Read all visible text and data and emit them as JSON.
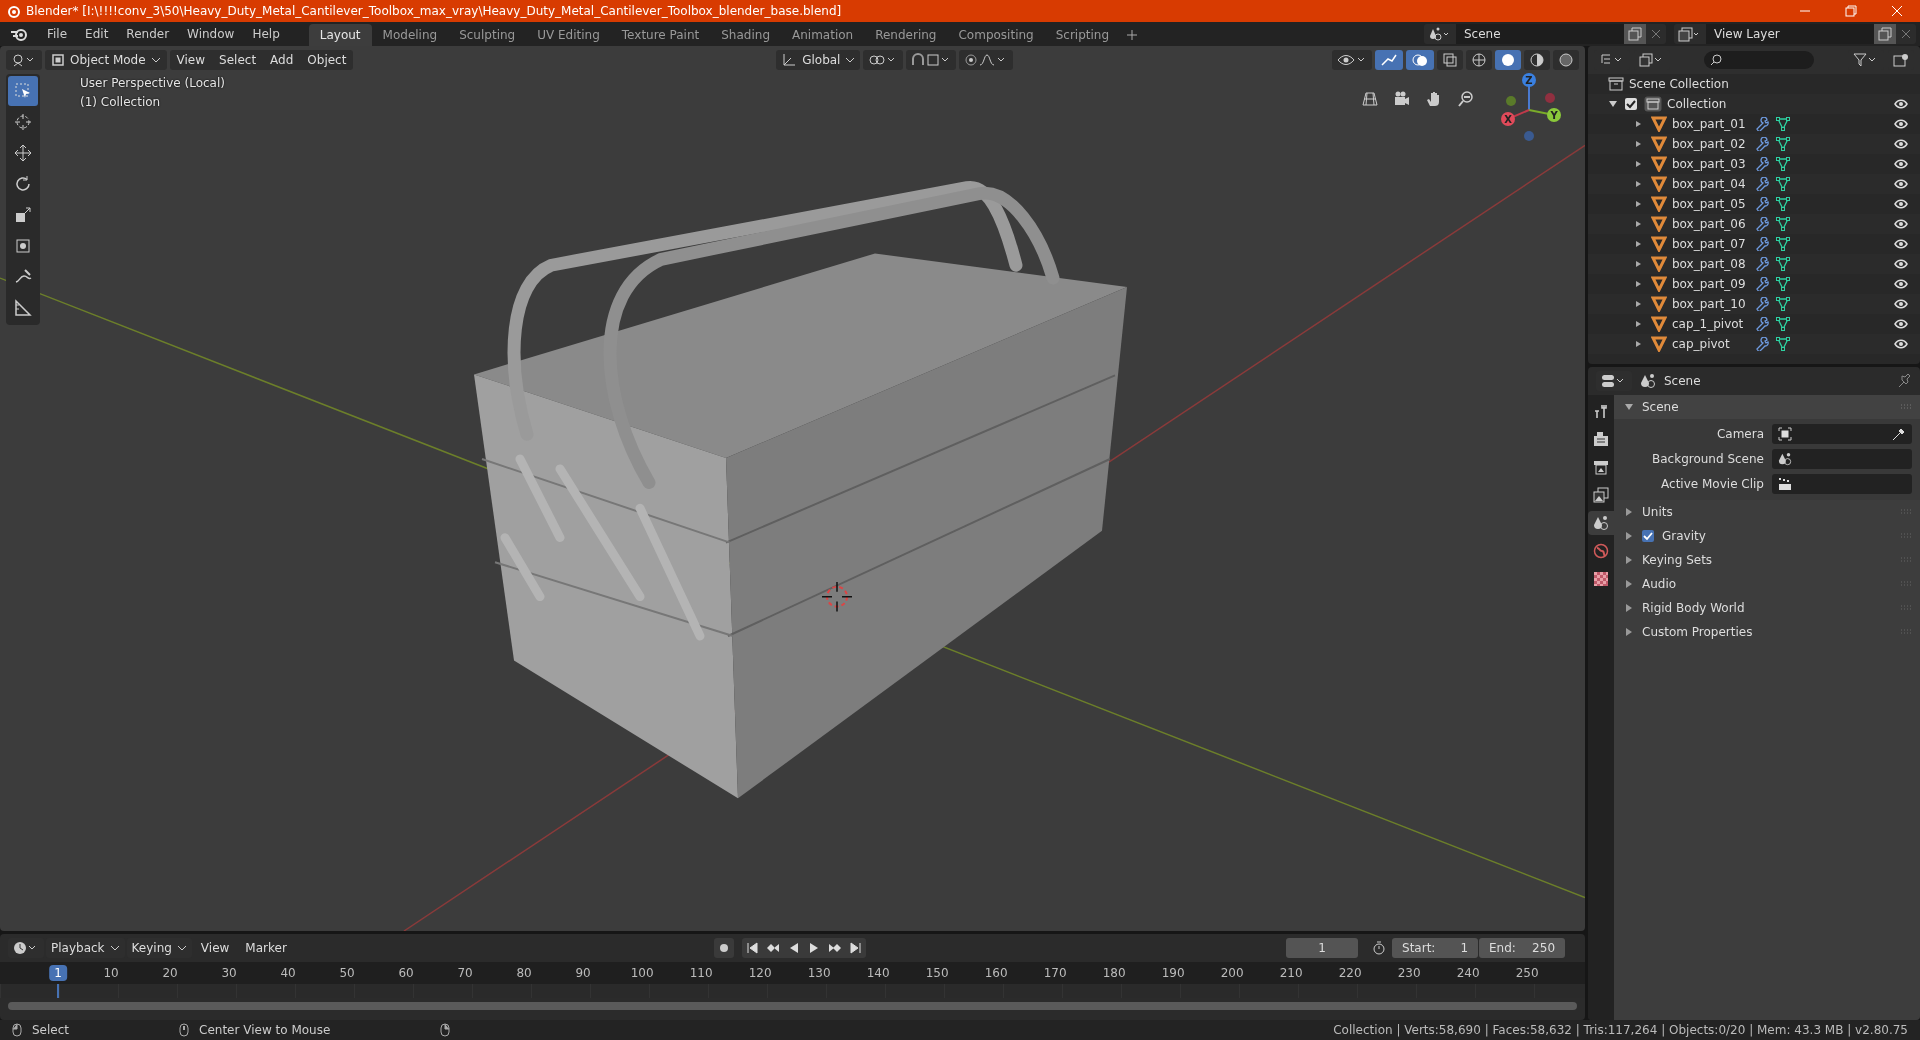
{
  "title_bar": {
    "title": "Blender* [I:\\!!!!conv_3\\50\\Heavy_Duty_Metal_Cantilever_Toolbox_max_vray\\Heavy_Duty_Metal_Cantilever_Toolbox_blender_base.blend]"
  },
  "menu": [
    "File",
    "Edit",
    "Render",
    "Window",
    "Help"
  ],
  "workspaces": [
    {
      "label": "Layout",
      "selected": true
    },
    {
      "label": "Modeling",
      "selected": false
    },
    {
      "label": "Sculpting",
      "selected": false
    },
    {
      "label": "UV Editing",
      "selected": false
    },
    {
      "label": "Texture Paint",
      "selected": false
    },
    {
      "label": "Shading",
      "selected": false
    },
    {
      "label": "Animation",
      "selected": false
    },
    {
      "label": "Rendering",
      "selected": false
    },
    {
      "label": "Compositing",
      "selected": false
    },
    {
      "label": "Scripting",
      "selected": false
    }
  ],
  "scene_field": {
    "value": "Scene"
  },
  "view_layer_field": {
    "value": "View Layer"
  },
  "viewport": {
    "mode": "Object Mode",
    "menus": [
      "View",
      "Select",
      "Add",
      "Object"
    ],
    "orientation": "Global",
    "overlay_lines": [
      "User Perspective (Local)",
      "(1) Collection"
    ],
    "gizmo_axes": [
      "X",
      "Y",
      "Z"
    ],
    "tools": [
      {
        "kind": "select",
        "selected": true
      },
      {
        "kind": "cursor",
        "selected": false
      },
      {
        "kind": "move",
        "selected": false
      },
      {
        "kind": "rotate",
        "selected": false
      },
      {
        "kind": "scale",
        "selected": false
      },
      {
        "kind": "transform",
        "selected": false
      },
      {
        "kind": "annotate",
        "selected": false
      },
      {
        "kind": "measure",
        "selected": false
      }
    ]
  },
  "outliner": {
    "root": "Scene Collection",
    "collection": {
      "name": "Collection",
      "checked": true,
      "expanded": true,
      "children": [
        {
          "name": "box_part_01"
        },
        {
          "name": "box_part_02"
        },
        {
          "name": "box_part_03"
        },
        {
          "name": "box_part_04"
        },
        {
          "name": "box_part_05"
        },
        {
          "name": "box_part_06"
        },
        {
          "name": "box_part_07"
        },
        {
          "name": "box_part_08"
        },
        {
          "name": "box_part_09"
        },
        {
          "name": "box_part_10"
        },
        {
          "name": "cap_1_pivot"
        },
        {
          "name": "cap_pivot"
        }
      ]
    }
  },
  "properties": {
    "header": "Scene",
    "tabs": [
      {
        "kind": "tool",
        "selected": false
      },
      {
        "kind": "render",
        "selected": false
      },
      {
        "kind": "output",
        "selected": false
      },
      {
        "kind": "view_layer",
        "selected": false
      },
      {
        "kind": "scene",
        "selected": true
      },
      {
        "kind": "world",
        "selected": false
      },
      {
        "kind": "texture",
        "selected": false
      }
    ],
    "section": {
      "title": "Scene",
      "expanded": true,
      "fields": [
        {
          "label": "Camera",
          "kind": "camera"
        },
        {
          "label": "Background Scene",
          "kind": "scene"
        },
        {
          "label": "Active Movie Clip",
          "kind": "clip"
        }
      ]
    },
    "panels": [
      {
        "title": "Units",
        "kind": "plain"
      },
      {
        "title": "Gravity",
        "kind": "checkbox",
        "checked": true
      },
      {
        "title": "Keying Sets",
        "kind": "plain"
      },
      {
        "title": "Audio",
        "kind": "plain"
      },
      {
        "title": "Rigid Body World",
        "kind": "plain"
      },
      {
        "title": "Custom Properties",
        "kind": "plain"
      }
    ]
  },
  "timeline": {
    "menus": [
      "Playback",
      "Keying",
      "View",
      "Marker"
    ],
    "current_frame": "1",
    "start_label": "Start:",
    "start": "1",
    "end_label": "End:",
    "end": "250",
    "ruler": [
      {
        "label": "1",
        "selected": true
      },
      {
        "label": "10",
        "selected": false
      },
      {
        "label": "20",
        "selected": false
      },
      {
        "label": "30",
        "selected": false
      },
      {
        "label": "40",
        "selected": false
      },
      {
        "label": "50",
        "selected": false
      },
      {
        "label": "60",
        "selected": false
      },
      {
        "label": "70",
        "selected": false
      },
      {
        "label": "80",
        "selected": false
      },
      {
        "label": "90",
        "selected": false
      },
      {
        "label": "100",
        "selected": false
      },
      {
        "label": "110",
        "selected": false
      },
      {
        "label": "120",
        "selected": false
      },
      {
        "label": "130",
        "selected": false
      },
      {
        "label": "140",
        "selected": false
      },
      {
        "label": "150",
        "selected": false
      },
      {
        "label": "160",
        "selected": false
      },
      {
        "label": "170",
        "selected": false
      },
      {
        "label": "180",
        "selected": false
      },
      {
        "label": "190",
        "selected": false
      },
      {
        "label": "200",
        "selected": false
      },
      {
        "label": "210",
        "selected": false
      },
      {
        "label": "220",
        "selected": false
      },
      {
        "label": "230",
        "selected": false
      },
      {
        "label": "240",
        "selected": false
      },
      {
        "label": "250",
        "selected": false
      }
    ]
  },
  "status_bar": {
    "hints": [
      "Select",
      "Center View to Mouse"
    ],
    "stats": "Collection | Verts:58,690 | Faces:58,632 | Tris:117,264 | Objects:0/20 | Mem: 43.3 MB | v2.80.75"
  }
}
